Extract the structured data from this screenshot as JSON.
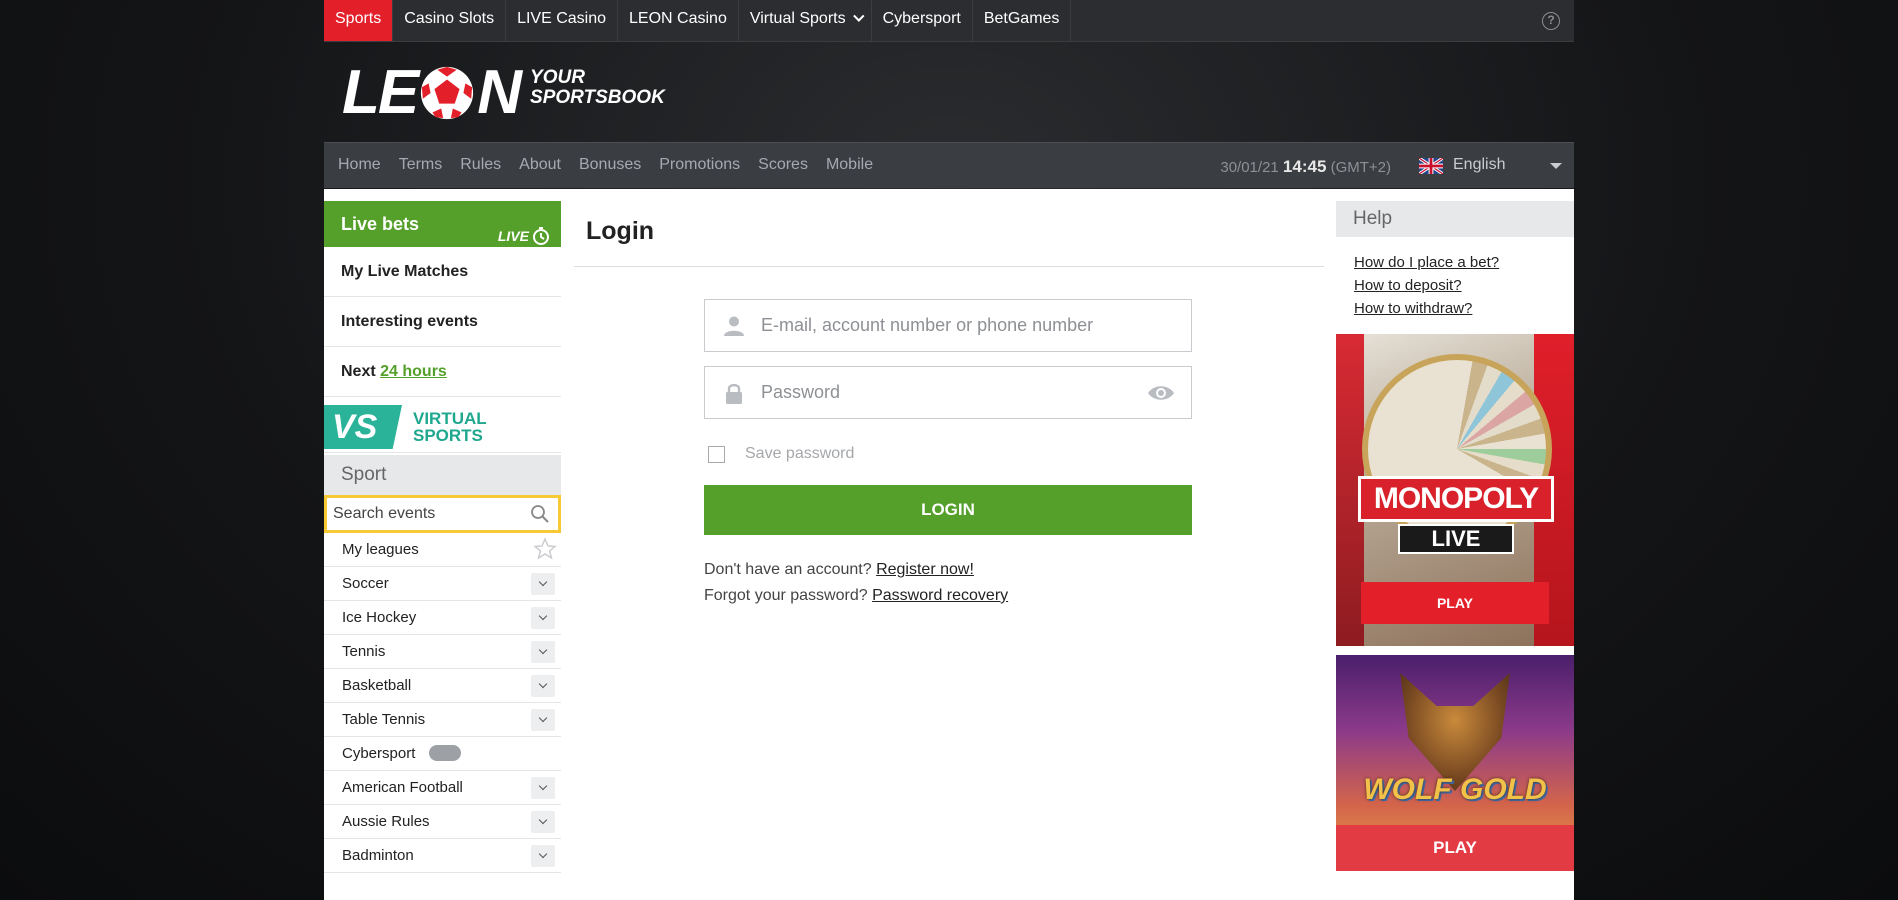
{
  "topnav": {
    "items": [
      "Sports",
      "Casino Slots",
      "LIVE Casino",
      "LEON Casino",
      "Virtual Sports",
      "Cybersport",
      "BetGames"
    ],
    "help_glyph": "?"
  },
  "logo": {
    "word_left": "LE",
    "word_right": "N",
    "tagline_1": "YOUR",
    "tagline_2": "SPORTSBOOK"
  },
  "menu": {
    "items": [
      "Home",
      "Terms",
      "Rules",
      "About",
      "Bonuses",
      "Promotions",
      "Scores",
      "Mobile"
    ],
    "date": "30/01/21",
    "time": "14:45",
    "timezone": "(GMT+2)",
    "language": "English"
  },
  "sidebar": {
    "live_bets": "Live bets",
    "live_tag": "LIVE",
    "my_live_matches": "My Live Matches",
    "interesting_events": "Interesting events",
    "next_prefix": "Next",
    "next_link": "24 hours",
    "vs_badge": "VS",
    "vs_line1": "VIRTUAL",
    "vs_line2": "SPORTS",
    "sport_header": "Sport",
    "search_placeholder": "Search events",
    "sports": [
      "My leagues",
      "Soccer",
      "Ice Hockey",
      "Tennis",
      "Basketball",
      "Table Tennis",
      "Cybersport",
      "American Football",
      "Aussie Rules",
      "Badminton"
    ]
  },
  "login": {
    "title": "Login",
    "email_placeholder": "E-mail, account number or phone number",
    "password_placeholder": "Password",
    "save_password": "Save password",
    "login_button": "LOGIN",
    "no_account": "Don't have an account?",
    "register_link": "Register now!",
    "forgot": "Forgot your password?",
    "recovery_link": "Password recovery"
  },
  "help": {
    "header": "Help",
    "links": [
      "How do I place a bet?",
      "How to deposit?",
      "How to withdraw?"
    ]
  },
  "promos": {
    "monopoly_title": "MONOPOLY",
    "monopoly_live": "LIVE",
    "monopoly_play": "PLAY",
    "wolf_title": "WOLF GOLD",
    "wolf_play": "PLAY"
  },
  "colors": {
    "accent_red": "#e3202a",
    "accent_green": "#55a02b",
    "vs_teal": "#2bb39a",
    "search_border": "#f7c935"
  }
}
